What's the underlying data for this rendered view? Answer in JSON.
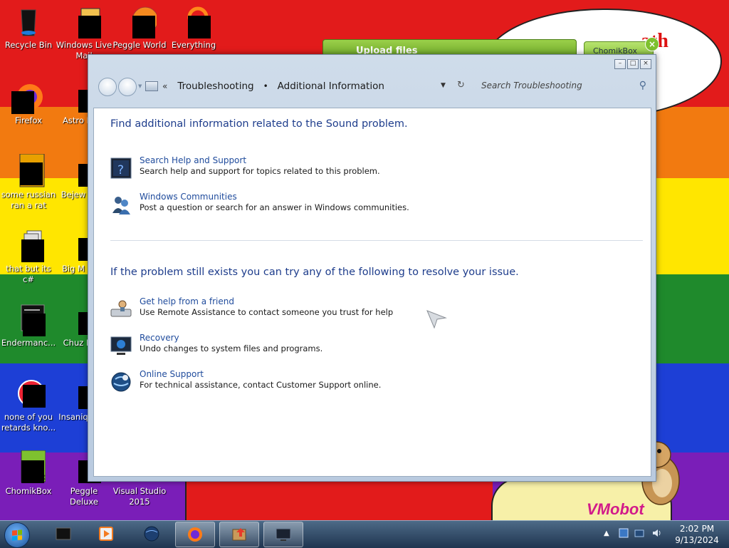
{
  "desktop": {
    "background_colors": [
      "#e21b1b",
      "#f27a10",
      "#ffe600",
      "#1f8a2c",
      "#1d3fd6",
      "#7a1eb8"
    ],
    "cloud_text": "ath",
    "watermark": "VMobot",
    "icons": [
      {
        "label": "Recycle Bin"
      },
      {
        "label": "Windows Live Mail"
      },
      {
        "label": "Peggle World"
      },
      {
        "label": "Everything"
      },
      {
        "label": "Firefox"
      },
      {
        "label": "Astro Delu"
      },
      {
        "label": "some russian ran a rat"
      },
      {
        "label": "Bejew Delu"
      },
      {
        "label": "that but its c#"
      },
      {
        "label": "Big M Delu"
      },
      {
        "label": "Endermanc..."
      },
      {
        "label": "Chuz Delu"
      },
      {
        "label": "none of you retards kno..."
      },
      {
        "label": "Insaniq Delu"
      },
      {
        "label": "ChomikBox"
      },
      {
        "label": "Peggle Deluxe"
      },
      {
        "label": "Visual Studio 2015"
      }
    ]
  },
  "chomikbox": {
    "upload_label": "Upload files",
    "tab_label": "ChomikBox",
    "close_glyph": "×"
  },
  "window": {
    "controls": {
      "minimize": "–",
      "maximize": "□",
      "close": "×"
    },
    "breadcrumb": {
      "chevron": "«",
      "root": "Troubleshooting",
      "separator": "•",
      "current": "Additional Information"
    },
    "search_placeholder": "Search Troubleshooting",
    "section1_heading": "Find additional information related to the Sound problem.",
    "section1_items": [
      {
        "title": "Search Help and Support",
        "desc": "Search help and support for topics related to this problem.",
        "icon": "help-book-icon"
      },
      {
        "title": "Windows Communities",
        "desc": "Post a question or search for an answer in Windows communities.",
        "icon": "people-icon"
      }
    ],
    "section2_heading": "If the problem still exists you can try any of the following to resolve your issue.",
    "section2_items": [
      {
        "title": "Get help from a friend",
        "desc": "Use Remote Assistance to contact someone you trust for help",
        "icon": "remote-assistance-icon"
      },
      {
        "title": "Recovery",
        "desc": "Undo changes to system files and programs.",
        "icon": "recovery-monitor-icon"
      },
      {
        "title": "Online Support",
        "desc": "For technical assistance, contact Customer Support online.",
        "icon": "globe-support-icon"
      }
    ]
  },
  "taskbar": {
    "items": [
      "command-prompt-icon",
      "media-player-icon",
      "globe-icon",
      "firefox-icon",
      "chomikbox-icon",
      "monitor-icon"
    ],
    "clock_time": "2:02 PM",
    "clock_date": "9/13/2024",
    "tray_arrow": "▲"
  }
}
